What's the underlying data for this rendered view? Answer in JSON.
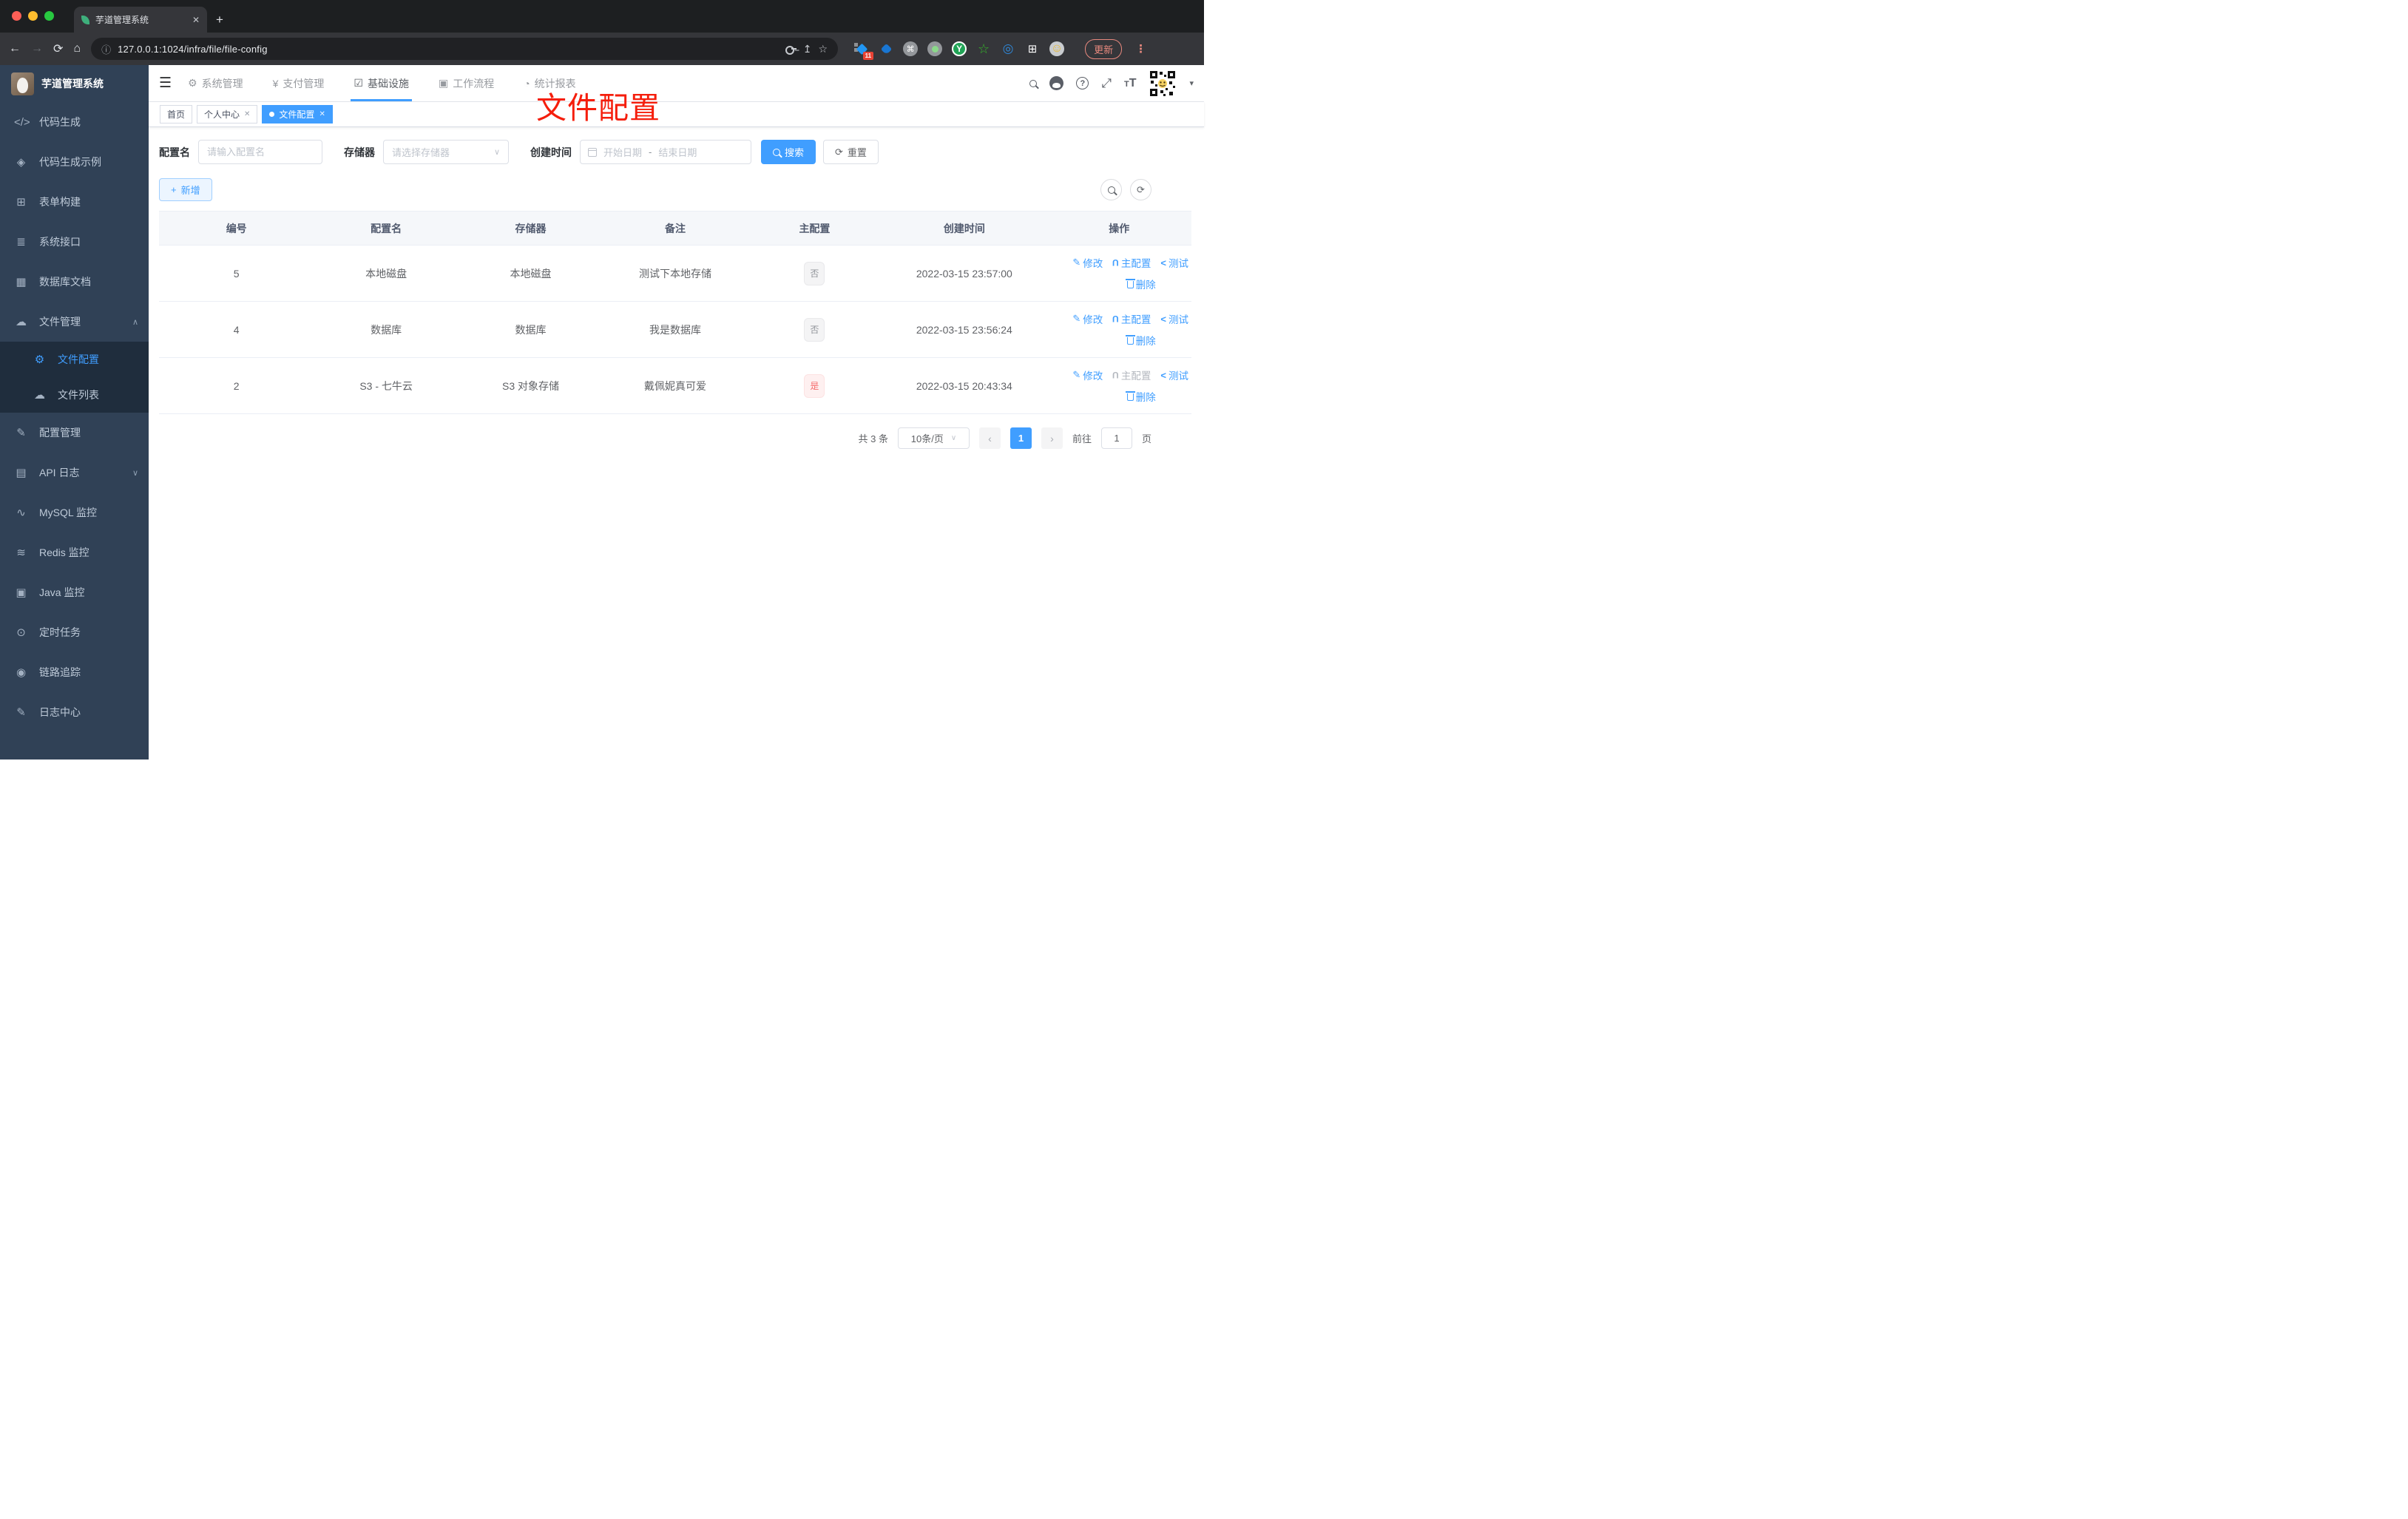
{
  "colors": {
    "accent": "#409eff",
    "sidebar_bg": "#304156",
    "submenu_bg": "#1f2d3d",
    "danger": "#f56c6c",
    "annotation_red": "#f51e0c",
    "chrome_dark": "#1d1f21",
    "chrome_grey": "#35363a"
  },
  "browser": {
    "tab_title": "芋道管理系统",
    "url": "127.0.0.1:1024/infra/file/file-config",
    "update_label": "更新",
    "ext_badge": "11"
  },
  "icons": {
    "close": "✕",
    "newtab": "+",
    "back": "←",
    "forward": "→",
    "reload": "⟳",
    "home": "⌂",
    "info": "ⓘ",
    "share": "↥",
    "star": "☆",
    "menu_dots": "⋮",
    "command": "⌘",
    "ext_y": "Y",
    "ext_star": "☆",
    "ext_eye": "◎",
    "puzzle": "⊞",
    "face": "☺",
    "hamburger": "☰",
    "chevron_up": "∧",
    "chevron_down": "∨",
    "caret": "▾",
    "sb_code": "</>",
    "sb_example": "◈",
    "sb_form": "⊞",
    "sb_api": "≣",
    "sb_db": "▦",
    "sb_file": "☁",
    "sb_gear": "⚙",
    "sb_list": "☁",
    "sb_cfg": "✎",
    "sb_log": "▤",
    "sb_mysql": "∿",
    "sb_redis": "≋",
    "sb_java": "▣",
    "sb_job": "⊙",
    "sb_trace": "◉",
    "sb_logcenter": "✎",
    "nav_sys": "⚙",
    "nav_pay": "¥",
    "nav_infra": "☑",
    "nav_flow": "▣",
    "nav_report": "◔",
    "help": "?",
    "fullscreen": "⤢",
    "font_small": "T",
    "font_big": "T",
    "plus": "+",
    "reset": "⟳",
    "refresh": "⟳",
    "edit": "✎",
    "master": "U",
    "test": "<",
    "prev": "‹",
    "next": "›"
  },
  "sidebar": {
    "title": "芋道管理系统",
    "items": [
      {
        "label": "代码生成"
      },
      {
        "label": "代码生成示例"
      },
      {
        "label": "表单构建"
      },
      {
        "label": "系统接口"
      },
      {
        "label": "数据库文档"
      },
      {
        "label": "文件管理"
      },
      {
        "label": "文件配置"
      },
      {
        "label": "文件列表"
      },
      {
        "label": "配置管理"
      },
      {
        "label": "API 日志"
      },
      {
        "label": "MySQL 监控"
      },
      {
        "label": "Redis 监控"
      },
      {
        "label": "Java 监控"
      },
      {
        "label": "定时任务"
      },
      {
        "label": "链路追踪"
      },
      {
        "label": "日志中心"
      }
    ]
  },
  "topnav": {
    "items": [
      {
        "label": "系统管理"
      },
      {
        "label": "支付管理"
      },
      {
        "label": "基础设施"
      },
      {
        "label": "工作流程"
      },
      {
        "label": "统计报表"
      }
    ]
  },
  "tags": [
    {
      "label": "首页"
    },
    {
      "label": "个人中心"
    },
    {
      "label": "文件配置"
    }
  ],
  "annotation": "文件配置",
  "filters": {
    "name_label": "配置名",
    "name_placeholder": "请输入配置名",
    "storage_label": "存储器",
    "storage_placeholder": "请选择存储器",
    "time_label": "创建时间",
    "start_placeholder": "开始日期",
    "range_separator": "-",
    "end_placeholder": "结束日期",
    "search": "搜索",
    "reset": "重置"
  },
  "toolbar": {
    "add": "新增"
  },
  "table": {
    "headers": [
      "编号",
      "配置名",
      "存储器",
      "备注",
      "主配置",
      "创建时间",
      "操作"
    ],
    "action_labels": {
      "edit": "修改",
      "master": "主配置",
      "test": "测试",
      "delete": "删除"
    },
    "rows": [
      {
        "id": "5",
        "name": "本地磁盘",
        "storage": "本地磁盘",
        "remark": "测试下本地存储",
        "master": "否",
        "time": "2022-03-15 23:57:00"
      },
      {
        "id": "4",
        "name": "数据库",
        "storage": "数据库",
        "remark": "我是数据库",
        "master": "否",
        "time": "2022-03-15 23:56:24"
      },
      {
        "id": "2",
        "name": "S3 - 七牛云",
        "storage": "S3 对象存储",
        "remark": "戴佩妮真可爱",
        "master": "是",
        "time": "2022-03-15 20:43:34"
      }
    ]
  },
  "pagination": {
    "total": "共 3 条",
    "page_size": "10条/页",
    "page": "1",
    "goto": "前往",
    "page_suffix": "页",
    "goto_value": "1"
  }
}
